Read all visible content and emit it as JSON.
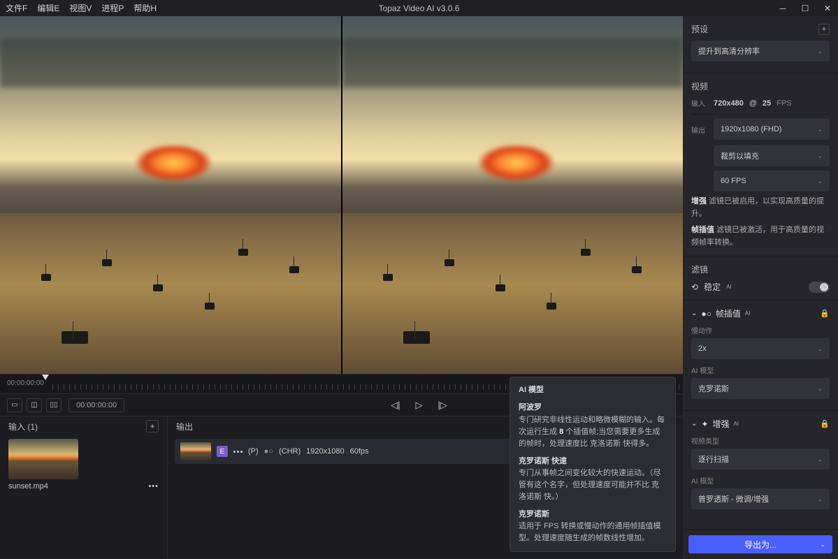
{
  "app": {
    "title": "Topaz Video AI   v3.0.6"
  },
  "menu": {
    "file": "文件F",
    "edit": "编辑E",
    "view": "视图V",
    "process": "进程P",
    "help": "帮助H"
  },
  "timeline": {
    "start": "00:00:00:00",
    "pos": "00:00:00:00"
  },
  "input_panel": {
    "title": "输入 (1)",
    "file": "sunset.mp4"
  },
  "output_panel": {
    "title": "输出",
    "row": {
      "badge": "E",
      "p": "(P)",
      "chr": "(CHR)",
      "res": "1920x1080",
      "fps": "60fps"
    }
  },
  "tooltip": {
    "header": "AI 模型",
    "m1": {
      "name": "阿波罗",
      "desc_a": "专门研究非线性运动和略微模糊的输入。每次运行生成 ",
      "frames": "8",
      "desc_b": " 个插值帧;当您需要更多生成的帧时，处理速度比 克洛诺斯 快得多。"
    },
    "m2": {
      "name": "克罗诺斯 快速",
      "desc": "专门从事帧之间变化较大的快速运动。（尽管有这个名字，但处理速度可能并不比 克洛诺斯 快。）"
    },
    "m3": {
      "name": "克罗诺斯",
      "desc": "适用于 FPS 转换或慢动作的通用帧插值模型。处理速度随生成的帧数线性增加。"
    }
  },
  "sidebar": {
    "preset": {
      "title": "预设",
      "value": "提升到高清分辨率"
    },
    "video": {
      "title": "视频",
      "in_label": "输入",
      "in_res": "720x480",
      "in_at": "@",
      "in_fps": "25",
      "in_fps_unit": "FPS",
      "out_label": "输出",
      "out_res": "1920x1080 (FHD)",
      "crop": "裁剪以填充",
      "fps": "60 FPS",
      "enhance_b": "增强",
      "enhance_t": " 滤镜已被启用，以实现高质量的提升。",
      "interp_b": "帧插值",
      "interp_t": " 滤镜已被激活，用于高质量的视频帧率转换。"
    },
    "filters": {
      "title": "滤镜",
      "stab": "稳定",
      "ai": "AI"
    },
    "interp": {
      "title": "帧插值",
      "ai": "AI",
      "slowmo_label": "慢动作",
      "slowmo_val": "2x",
      "model_label": "AI 模型",
      "model_val": "克罗诺斯"
    },
    "enhance": {
      "title": "增强",
      "ai": "AI",
      "vtype_label": "视频类型",
      "vtype_val": "逐行扫描",
      "model_label": "AI 模型",
      "model_val": "普罗透斯 - 微调/增强"
    },
    "export": "导出为..."
  }
}
